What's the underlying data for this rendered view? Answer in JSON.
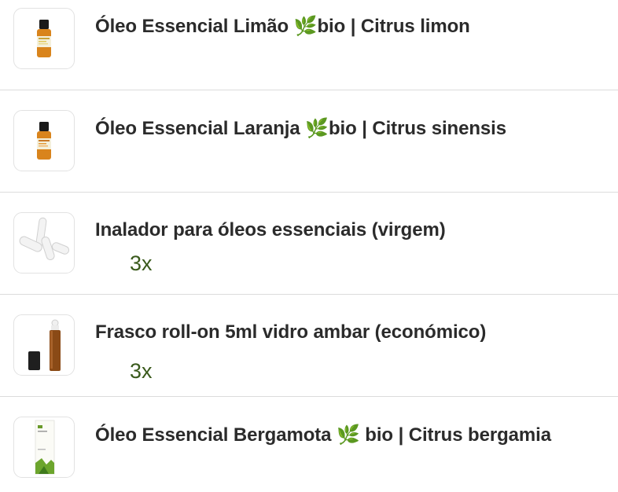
{
  "items": [
    {
      "title": "Óleo Essencial Limão 🌿bio | Citrus limon",
      "image_icon": "amber-essential-oil-bottle-yellow-label",
      "qty": ""
    },
    {
      "title": "Óleo Essencial Laranja 🌿bio | Citrus sinensis",
      "image_icon": "amber-essential-oil-bottle-orange-label",
      "qty": ""
    },
    {
      "title": "Inalador para óleos essenciais (virgem)",
      "image_icon": "white-nasal-inhalers",
      "qty": "3x"
    },
    {
      "title": "Frasco roll-on 5ml vidro ambar (económico)",
      "image_icon": "amber-roll-on-bottle-with-cap",
      "qty": "3x"
    },
    {
      "title": "Óleo Essencial Bergamota 🌿 bio | Citrus bergamia",
      "image_icon": "white-green-product-box",
      "qty": ""
    }
  ],
  "colors": {
    "title": "#2b2b2b",
    "quantity": "#3a5a1c",
    "divider": "#dcdcdc"
  }
}
